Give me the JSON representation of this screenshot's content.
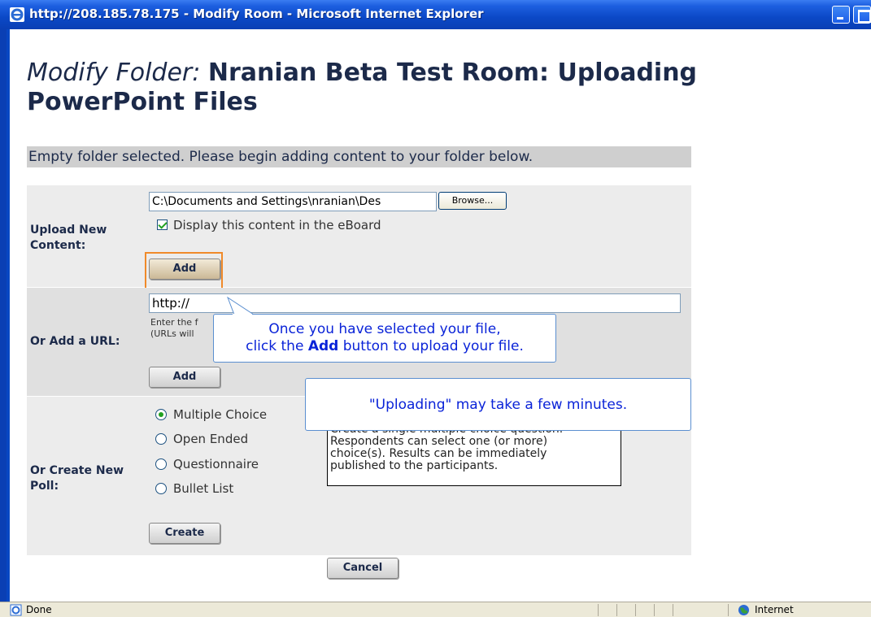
{
  "window": {
    "title": "http://208.185.78.175 - Modify Room - Microsoft Internet Explorer"
  },
  "heading": {
    "prefix": "Modify Folder:",
    "name": "Nranian Beta Test Room: Uploading PowerPoint Files"
  },
  "notice": "Empty folder selected.  Please begin adding content to your folder below.",
  "upload": {
    "label": "Upload New Content:",
    "file_value": "C:\\Documents and Settings\\nranian\\Des",
    "browse_label": "Browse...",
    "checkbox_label": "Display this content in the eBoard",
    "checkbox_checked": true,
    "add_label": "Add"
  },
  "url": {
    "label": "Or Add a URL:",
    "value": "http://",
    "help_line1": "Enter the f",
    "help_line2": "(URLs will",
    "add_label": "Add"
  },
  "poll": {
    "label": "Or Create New Poll:",
    "options": [
      {
        "label": "Multiple Choice",
        "selected": true
      },
      {
        "label": "Open Ended",
        "selected": false
      },
      {
        "label": "Questionnaire",
        "selected": false
      },
      {
        "label": "Bullet List",
        "selected": false
      }
    ],
    "description_line1": "Create a single multiple choice question.",
    "description_line2": "Respondents can select one (or more)",
    "description_line3": "choice(s). Results can be immediately",
    "description_line4": "published to the participants.",
    "create_label": "Create"
  },
  "cancel_label": "Cancel",
  "callouts": {
    "add_line1": "Once you have selected your file,",
    "add_line2_pre": "click the ",
    "add_line2_bold": "Add",
    "add_line2_post": " button to upload your file.",
    "uploading": "\"Uploading\" may take a few minutes."
  },
  "statusbar": {
    "status": "Done",
    "zone": "Internet"
  },
  "colors": {
    "titlebar": "#0a48c6",
    "callout_text": "#0a23d8",
    "highlight": "#f08a2a"
  }
}
